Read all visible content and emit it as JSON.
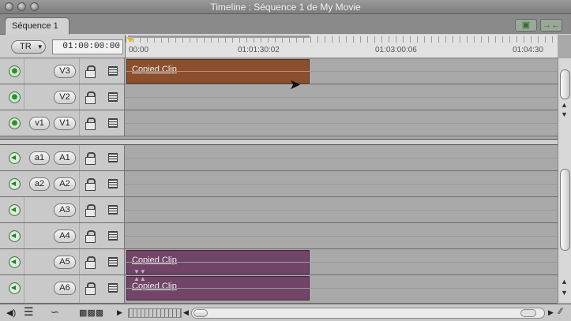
{
  "window": {
    "title": "Timeline : Séquence 1 de My Movie"
  },
  "tabs": [
    {
      "label": "Séquence 1"
    }
  ],
  "header": {
    "target_label": "TR",
    "timecode": "01:00:00:00",
    "right_icons": [
      "linking-icon",
      "snapping-icon"
    ]
  },
  "ruler": {
    "labels": [
      "00:00",
      "01:01:30:02",
      "01:03:00:06",
      "01:04:30"
    ]
  },
  "video_tracks": [
    {
      "name": "V3",
      "source": "",
      "clip": "Copied Clip"
    },
    {
      "name": "V2",
      "source": "",
      "clip": ""
    },
    {
      "name": "V1",
      "source": "v1",
      "clip": ""
    }
  ],
  "audio_tracks": [
    {
      "name": "A1",
      "source": "a1",
      "clip": ""
    },
    {
      "name": "A2",
      "source": "a2",
      "clip": ""
    },
    {
      "name": "A3",
      "source": "",
      "clip": ""
    },
    {
      "name": "A4",
      "source": "",
      "clip": ""
    },
    {
      "name": "A5",
      "source": "",
      "clip": "Copied Clip"
    },
    {
      "name": "A6",
      "source": "",
      "clip": "Copied Clip"
    }
  ],
  "colors": {
    "video_clip": "#8b4f2e",
    "audio_clip": "#714468",
    "playhead": "#e0c020"
  }
}
